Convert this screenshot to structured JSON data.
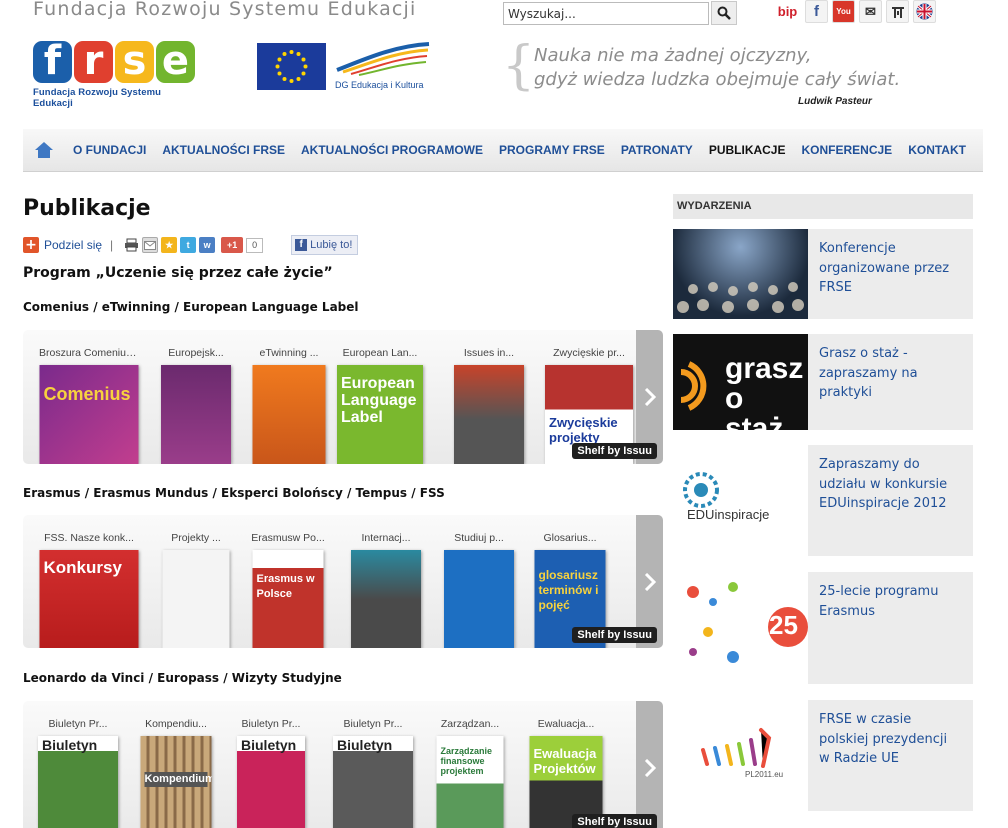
{
  "header": {
    "site_title": "Fundacja Rozwoju Systemu Edukacji",
    "logo_letters": [
      "f",
      "r",
      "s",
      "e"
    ],
    "logo_caption": "Fundacja Rozwoju Systemu Edukacji",
    "dg_caption": "DG Edukacja i Kultura",
    "search_value": "Wyszukaj...",
    "social": {
      "bip": "bip",
      "facebook": "f",
      "youtube": "You",
      "email": "✉"
    },
    "quote_line1": "Nauka nie ma żadnej ojczyzny,",
    "quote_line2": "gdyż wiedza ludzka obejmuje cały świat.",
    "quote_author": "Ludwik Pasteur"
  },
  "nav": {
    "items": [
      "O FUNDACJI",
      "AKTUALNOŚCI FRSE",
      "AKTUALNOŚCI PROGRAMOWE",
      "PROGRAMY FRSE",
      "PATRONATY",
      "PUBLIKACJE",
      "KONFERENCJE",
      "KONTAKT"
    ],
    "active": "PUBLIKACJE"
  },
  "main": {
    "title": "Publikacje",
    "share_label": "Podziel się",
    "share_sep": "|",
    "gplus_label": "+1",
    "gplus_count": "0",
    "fb_like": "Lubię to!",
    "program_heading": "Program „Uczenie się przez całe życie”",
    "shelf_badge": "Shelf by Issuu",
    "sections": [
      {
        "heading": "Comenius / eTwinning / European Language Label",
        "books": [
          {
            "title": "Broszura Comenius...",
            "cover_text": "Comenius"
          },
          {
            "title": "Europejsk...",
            "cover_text": ""
          },
          {
            "title": "eTwinning ...",
            "cover_text": ""
          },
          {
            "title": "European Lan...",
            "cover_text": "European Language Label"
          },
          {
            "title": "Issues in...",
            "cover_text": ""
          },
          {
            "title": "Zwycięskie pr...",
            "cover_text": "Zwycięskie projekty"
          }
        ]
      },
      {
        "heading": "Erasmus / Erasmus Mundus / Eksperci Bolońscy / Tempus / FSS",
        "books": [
          {
            "title": "FSS. Nasze konk...",
            "cover_text": "Konkursy"
          },
          {
            "title": "Projekty ...",
            "cover_text": ""
          },
          {
            "title": "Erasmusw Po...",
            "cover_text": "Erasmus w Polsce"
          },
          {
            "title": "Internacj...",
            "cover_text": ""
          },
          {
            "title": "Studiuj p...",
            "cover_text": ""
          },
          {
            "title": "Glosarius...",
            "cover_text": "glosariusz terminów i pojęć"
          }
        ]
      },
      {
        "heading": "Leonardo da Vinci / Europass / Wizyty Studyjne",
        "books": [
          {
            "title": "Biuletyn Pr...",
            "cover_text": "Biuletyn"
          },
          {
            "title": "Kompendiu...",
            "cover_text": "Kompendium"
          },
          {
            "title": "Biuletyn Pr...",
            "cover_text": "Biuletyn"
          },
          {
            "title": "Biuletyn Pr...",
            "cover_text": "Biuletyn"
          },
          {
            "title": "Zarządzan...",
            "cover_text": "Zarządzanie finansowe projektem"
          },
          {
            "title": "Ewaluacja...",
            "cover_text": "Ewaluacja Projektów"
          }
        ]
      }
    ]
  },
  "sidebar": {
    "heading": "WYDARZENIA",
    "events": [
      {
        "text": "Konferencje organizowane przez FRSE"
      },
      {
        "text": "Grasz o staż - zapraszamy na praktyki",
        "image_text": "grasz o staż"
      },
      {
        "text": "Zapraszamy do udziału w konkursie EDUinspiracje 2012",
        "image_text": "EDUinspiracje"
      },
      {
        "text": "25-lecie programu Erasmus",
        "image_text": "25"
      },
      {
        "text": "FRSE w czasie polskiej prezydencji w Radzie UE",
        "image_text": "PL2011.eu"
      }
    ]
  },
  "colors": {
    "link_blue": "#1f4f97",
    "frse_f": "#1b5faa",
    "frse_r": "#e0402f",
    "frse_s": "#f6b81c",
    "frse_e": "#72b52e"
  }
}
